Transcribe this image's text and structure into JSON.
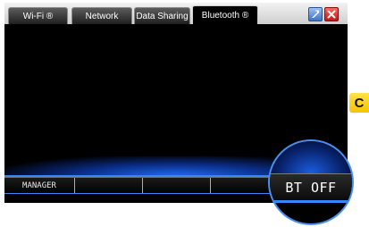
{
  "tabs": [
    {
      "label": "Wi-Fi ®"
    },
    {
      "label": "Network"
    },
    {
      "label": "Data Sharing"
    },
    {
      "label": "Bluetooth ®"
    }
  ],
  "active_tab": "Bluetooth ®",
  "bottom_bar": {
    "segments": [
      {
        "label": "MANAGER"
      },
      {
        "label": ""
      },
      {
        "label": ""
      },
      {
        "label": ""
      }
    ]
  },
  "status": {
    "bluetooth": "BT OFF"
  },
  "side_badge": {
    "label": "C",
    "color": "#f4c400"
  },
  "icons": {
    "help": "help-icon",
    "close": "close-icon"
  },
  "colors": {
    "accent": "#3a86ff",
    "background": "#000000",
    "close_button": "#d0201c",
    "help_button": "#4a7fd0"
  }
}
